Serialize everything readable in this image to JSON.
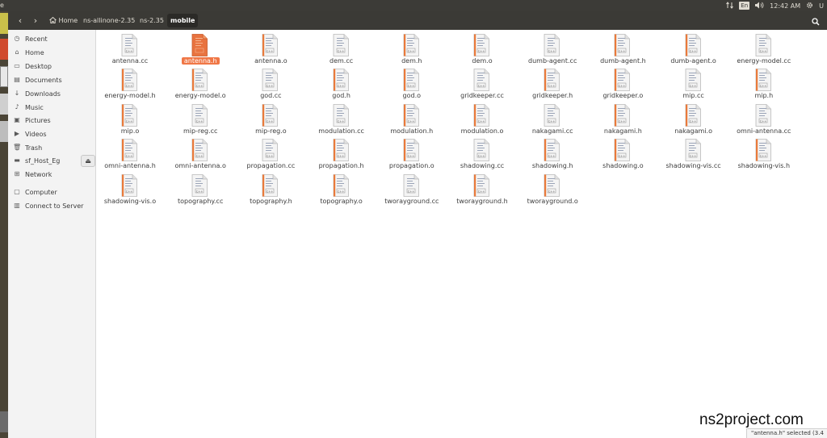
{
  "topbar": {
    "app_fragment": "e",
    "keyboard": "En",
    "time": "12:42 AM",
    "user_fragment": "U"
  },
  "toolbar": {
    "back_glyph": "‹",
    "forward_glyph": "›",
    "breadcrumbs": [
      "Home",
      "ns-allinone-2.35",
      "ns-2.35",
      "mobile"
    ]
  },
  "sidebar": {
    "items": [
      {
        "label": "Recent",
        "icon": "clock-icon"
      },
      {
        "label": "Home",
        "icon": "home-icon"
      },
      {
        "label": "Desktop",
        "icon": "desktop-icon"
      },
      {
        "label": "Documents",
        "icon": "documents-icon"
      },
      {
        "label": "Downloads",
        "icon": "downloads-icon"
      },
      {
        "label": "Music",
        "icon": "music-icon"
      },
      {
        "label": "Pictures",
        "icon": "pictures-icon"
      },
      {
        "label": "Videos",
        "icon": "videos-icon"
      },
      {
        "label": "Trash",
        "icon": "trash-icon"
      },
      {
        "label": "sf_Host_Eg",
        "icon": "drive-icon"
      },
      {
        "label": "Network",
        "icon": "network-icon"
      },
      {
        "label": "Computer",
        "icon": "computer-icon"
      },
      {
        "label": "Connect to Server",
        "icon": "server-icon"
      }
    ]
  },
  "files": [
    {
      "name": "antenna.cc",
      "kind": "source"
    },
    {
      "name": "antenna.h",
      "kind": "header",
      "selected": true
    },
    {
      "name": "antenna.o",
      "kind": "object"
    },
    {
      "name": "dem.cc",
      "kind": "source"
    },
    {
      "name": "dem.h",
      "kind": "header"
    },
    {
      "name": "dem.o",
      "kind": "object"
    },
    {
      "name": "dumb-agent.cc",
      "kind": "source"
    },
    {
      "name": "dumb-agent.h",
      "kind": "header"
    },
    {
      "name": "dumb-agent.o",
      "kind": "object"
    },
    {
      "name": "energy-model.cc",
      "kind": "source"
    },
    {
      "name": "energy-model.h",
      "kind": "header"
    },
    {
      "name": "energy-model.o",
      "kind": "object"
    },
    {
      "name": "god.cc",
      "kind": "source"
    },
    {
      "name": "god.h",
      "kind": "header"
    },
    {
      "name": "god.o",
      "kind": "object"
    },
    {
      "name": "gridkeeper.cc",
      "kind": "source"
    },
    {
      "name": "gridkeeper.h",
      "kind": "header"
    },
    {
      "name": "gridkeeper.o",
      "kind": "object"
    },
    {
      "name": "mip.cc",
      "kind": "source"
    },
    {
      "name": "mip.h",
      "kind": "header"
    },
    {
      "name": "mip.o",
      "kind": "object"
    },
    {
      "name": "mip-reg.cc",
      "kind": "source"
    },
    {
      "name": "mip-reg.o",
      "kind": "object"
    },
    {
      "name": "modulation.cc",
      "kind": "source"
    },
    {
      "name": "modulation.h",
      "kind": "header"
    },
    {
      "name": "modulation.o",
      "kind": "object"
    },
    {
      "name": "nakagami.cc",
      "kind": "source"
    },
    {
      "name": "nakagami.h",
      "kind": "header"
    },
    {
      "name": "nakagami.o",
      "kind": "object"
    },
    {
      "name": "omni-antenna.cc",
      "kind": "source"
    },
    {
      "name": "omni-antenna.h",
      "kind": "header"
    },
    {
      "name": "omni-antenna.o",
      "kind": "object"
    },
    {
      "name": "propagation.cc",
      "kind": "source"
    },
    {
      "name": "propagation.h",
      "kind": "header"
    },
    {
      "name": "propagation.o",
      "kind": "object"
    },
    {
      "name": "shadowing.cc",
      "kind": "source"
    },
    {
      "name": "shadowing.h",
      "kind": "header"
    },
    {
      "name": "shadowing.o",
      "kind": "object"
    },
    {
      "name": "shadowing-vis.cc",
      "kind": "source"
    },
    {
      "name": "shadowing-vis.h",
      "kind": "header"
    },
    {
      "name": "shadowing-vis.o",
      "kind": "object"
    },
    {
      "name": "topography.cc",
      "kind": "source"
    },
    {
      "name": "topography.h",
      "kind": "header"
    },
    {
      "name": "topography.o",
      "kind": "object"
    },
    {
      "name": "tworayground.cc",
      "kind": "source"
    },
    {
      "name": "tworayground.h",
      "kind": "header"
    },
    {
      "name": "tworayground.o",
      "kind": "object"
    }
  ],
  "status": "\"antenna.h\" selected (3.4",
  "watermark": "ns2project.com",
  "colors": {
    "selection": "#f07746",
    "toolbar": "#3b3a36",
    "panel": "#3c3b37",
    "sidebar": "#f3f3f3"
  }
}
